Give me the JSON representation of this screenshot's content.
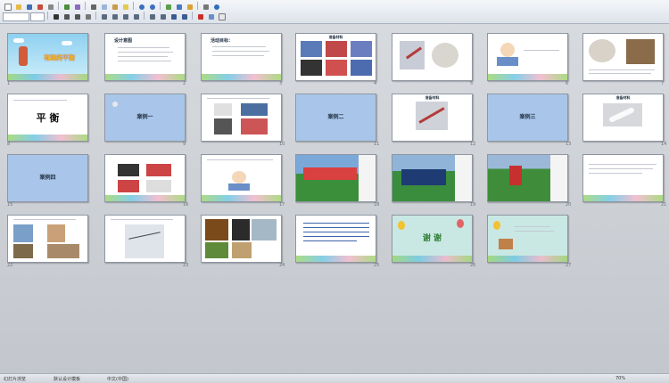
{
  "app": {
    "status_left": "幻灯片浏览",
    "status_mid": "默认设计模板",
    "status_lang": "中文(中国)",
    "zoom": "70%"
  },
  "toolbar": {
    "font_box": "",
    "size_box": ""
  },
  "slides": [
    {
      "n": "1",
      "title": "有趣的平衡",
      "style": "cover"
    },
    {
      "n": "2",
      "title": "设计意图",
      "style": "text"
    },
    {
      "n": "3",
      "title": "活动目标：",
      "style": "text"
    },
    {
      "n": "4",
      "title": "准备材料",
      "style": "collage"
    },
    {
      "n": "5",
      "title": "",
      "style": "photo"
    },
    {
      "n": "6",
      "title": "",
      "style": "cartoon"
    },
    {
      "n": "7",
      "title": "",
      "style": "photo"
    },
    {
      "n": "8",
      "title": "平 衡",
      "style": "title"
    },
    {
      "n": "9",
      "title": "案例一",
      "style": "blue"
    },
    {
      "n": "10",
      "title": "",
      "style": "photo"
    },
    {
      "n": "11",
      "title": "案例二",
      "style": "blue"
    },
    {
      "n": "12",
      "title": "准备材料",
      "style": "photo"
    },
    {
      "n": "13",
      "title": "案例三",
      "style": "blue"
    },
    {
      "n": "14",
      "title": "准备材料",
      "style": "photo"
    },
    {
      "n": "15",
      "title": "案例四",
      "style": "blue"
    },
    {
      "n": "16",
      "title": "",
      "style": "photo"
    },
    {
      "n": "17",
      "title": "",
      "style": "cartoon"
    },
    {
      "n": "18",
      "title": "",
      "style": "sport"
    },
    {
      "n": "19",
      "title": "",
      "style": "sport"
    },
    {
      "n": "20",
      "title": "",
      "style": "sport"
    },
    {
      "n": "21",
      "title": "",
      "style": "textscene"
    },
    {
      "n": "22",
      "title": "",
      "style": "photo"
    },
    {
      "n": "23",
      "title": "",
      "style": "photo"
    },
    {
      "n": "24",
      "title": "",
      "style": "photo"
    },
    {
      "n": "25",
      "title": "",
      "style": "textblock"
    },
    {
      "n": "26",
      "title": "谢 谢",
      "style": "thanks"
    },
    {
      "n": "27",
      "title": "",
      "style": "thanks2"
    }
  ]
}
